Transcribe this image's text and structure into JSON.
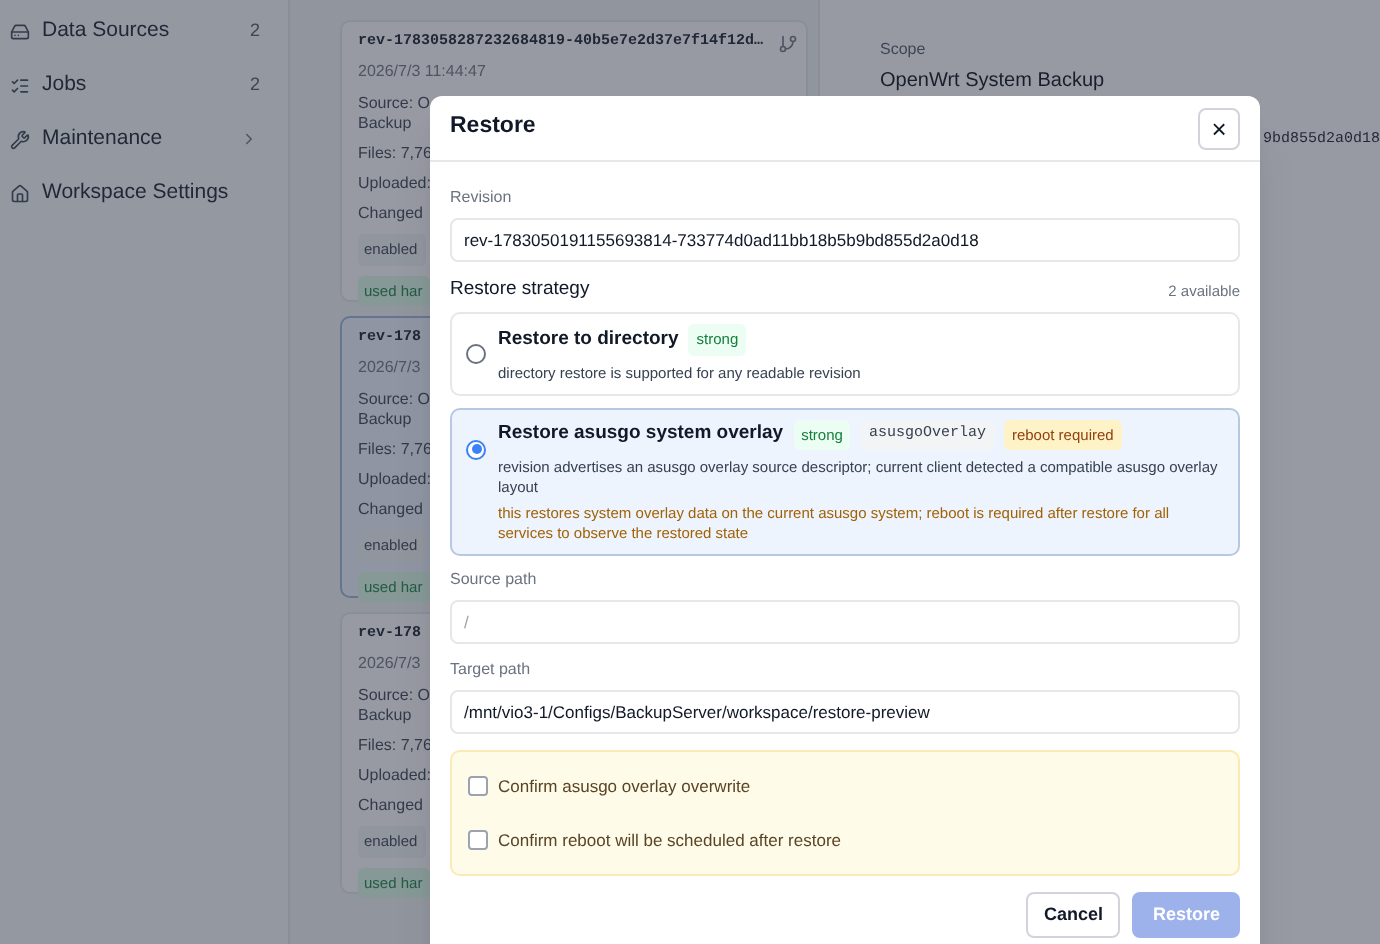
{
  "sidebar": {
    "items": [
      {
        "label": "Data Sources",
        "kind": "count",
        "count": "2"
      },
      {
        "label": "Jobs",
        "kind": "count",
        "count": "2"
      },
      {
        "label": "Maintenance",
        "kind": "group",
        "expanded": false
      },
      {
        "label": "Workspace Settings",
        "kind": "plain"
      }
    ]
  },
  "revisions": [
    {
      "id": "rev-1783058287232684819-40b5e7e2d37e7f14f12d…",
      "date": "2026/7/3 11:44:47",
      "link_icon": true,
      "selected": false,
      "lines": [
        "Source: O",
        "Backup",
        "Files: 7,76",
        "Uploaded:",
        "Changed"
      ],
      "tags": [
        {
          "label": "enabled",
          "kind": "neutral"
        },
        {
          "label": "used har",
          "kind": "success"
        }
      ]
    },
    {
      "id": "rev-178",
      "date": "2026/7/3",
      "selected": true,
      "lines": [
        "Source: O",
        "Backup",
        "Files: 7,76",
        "Uploaded:",
        "Changed"
      ],
      "tags": [
        {
          "label": "enabled",
          "kind": "neutral"
        },
        {
          "label": "used har",
          "kind": "success"
        }
      ]
    },
    {
      "id": "rev-178",
      "date": "2026/7/3",
      "selected": false,
      "lines": [
        "Source: O",
        "Backup",
        "Files: 7,76",
        "Uploaded:",
        "Changed"
      ],
      "tags": [
        {
          "label": "enabled",
          "kind": "neutral"
        },
        {
          "label": "used har",
          "kind": "success"
        }
      ]
    }
  ],
  "detail": {
    "fields": [
      {
        "label": "Scope",
        "value": "OpenWrt System Backup"
      }
    ],
    "revision_tail": "9bd855d2a0d18"
  },
  "dialog": {
    "title": "Restore",
    "close": "×",
    "revision": {
      "label": "Revision",
      "value": "rev-1783050191155693814-733774d0ad11bb18b5b9bd855d2a0d18"
    },
    "strategy": {
      "label": "Restore strategy",
      "count": "2 available",
      "options": [
        {
          "title": "Restore to directory",
          "selected": false,
          "badges": [
            {
              "label": "strong",
              "kind": "strong"
            }
          ],
          "description": "directory restore is supported for any readable revision"
        },
        {
          "title": "Restore asusgo system overlay",
          "selected": true,
          "badges": [
            {
              "label": "strong",
              "kind": "strong"
            },
            {
              "label": "asusgoOverlay",
              "kind": "code"
            },
            {
              "label": "reboot required",
              "kind": "warn"
            }
          ],
          "description": "revision advertises an asusgo overlay source descriptor; current client detected a compatible asusgo overlay layout",
          "note": "this restores system overlay data on the current asusgo system; reboot is required after restore for all services to observe the restored state"
        }
      ]
    },
    "source_path": {
      "label": "Source path",
      "placeholder": "/"
    },
    "target_path": {
      "label": "Target path",
      "value": "/mnt/vio3-1/Configs/BackupServer/workspace/restore-preview"
    },
    "confirmations": [
      {
        "label": "Confirm asusgo overlay overwrite",
        "checked": false
      },
      {
        "label": "Confirm reboot will be scheduled after restore",
        "checked": false
      }
    ],
    "buttons": {
      "cancel": "Cancel",
      "restore": {
        "label": "Restore",
        "disabled": true
      }
    }
  }
}
